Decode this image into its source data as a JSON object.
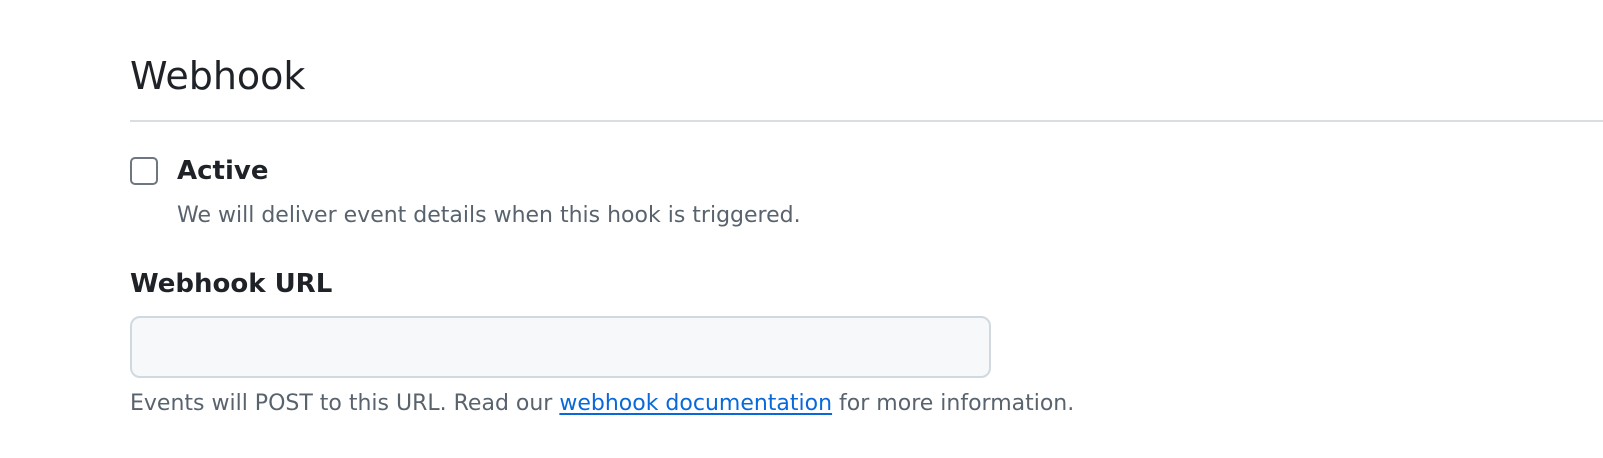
{
  "section": {
    "title": "Webhook"
  },
  "active_option": {
    "label": "Active",
    "checked": false,
    "description": "We will deliver event details when this hook is triggered."
  },
  "webhook_url": {
    "label": "Webhook URL",
    "value": "",
    "placeholder": "",
    "help_prefix": "Events will POST to this URL. Read our ",
    "help_link": "webhook documentation",
    "help_suffix": " for more information."
  },
  "colors": {
    "link": "#0969da",
    "muted_text": "#59636e",
    "input_background": "#f6f8fa"
  }
}
